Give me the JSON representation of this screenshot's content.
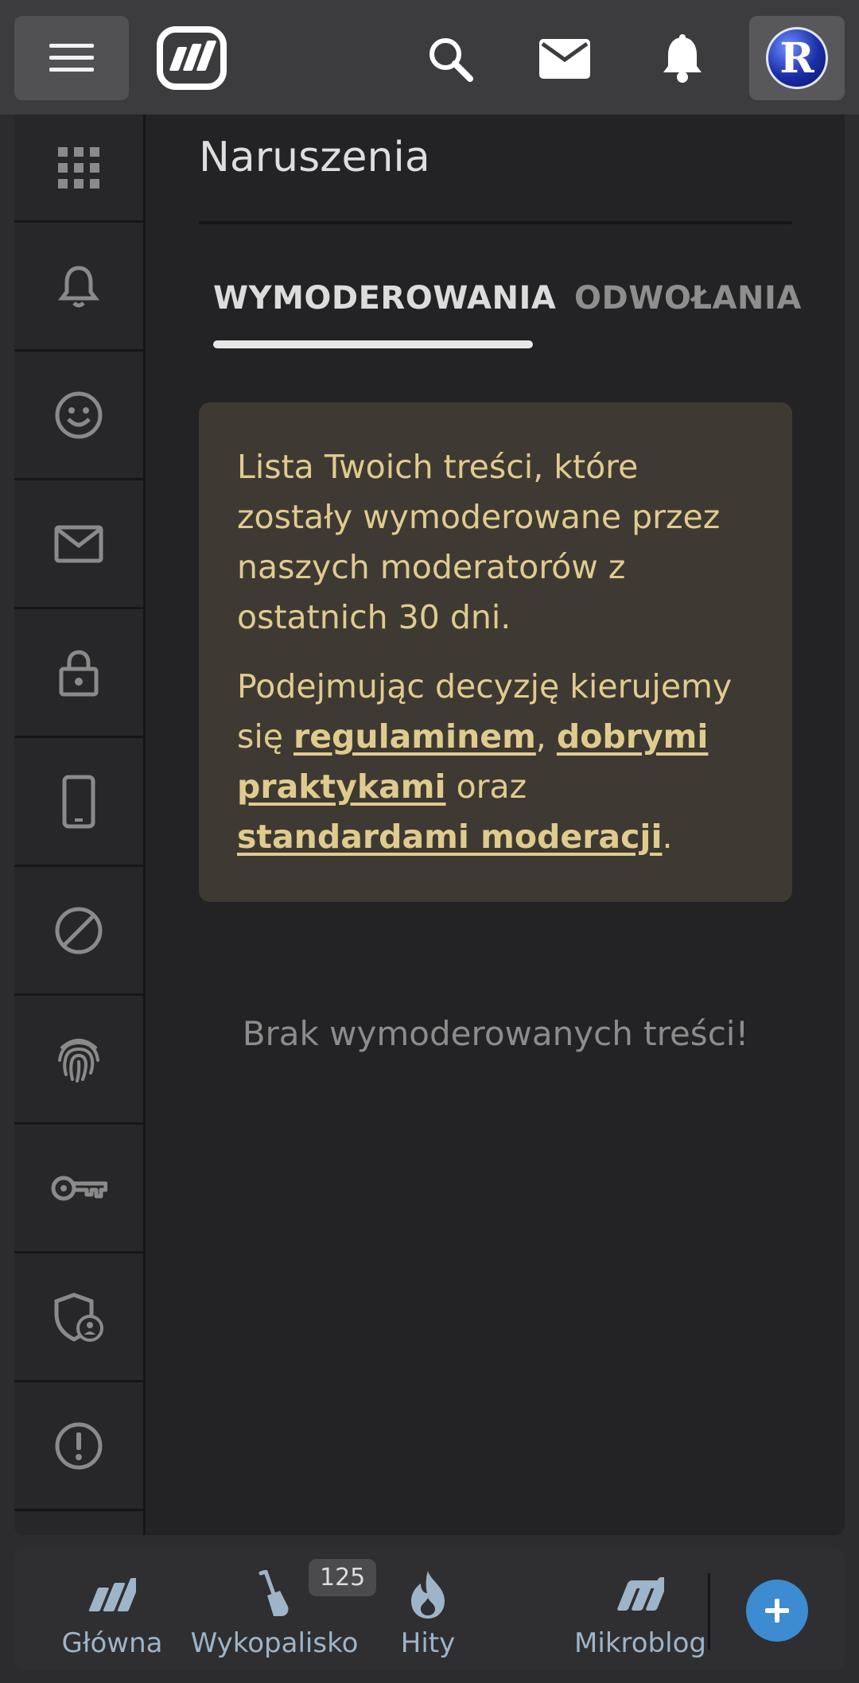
{
  "page": {
    "title": "Naruszenia"
  },
  "tabs": [
    {
      "label": "WYMODEROWANIA",
      "active": true
    },
    {
      "label": "ODWOŁANIA",
      "active": false
    }
  ],
  "notice": {
    "paragraph1": "Lista Twoich treści, które zostały wymoderowane przez naszych moderatorów z ostatnich 30 dni.",
    "p2_before": "Podejmując decyzję kierujemy się ",
    "link_regulamin": "regulaminem",
    "sep1": ", ",
    "link_praktyki": "dobrymi praktykami",
    "sep2": " oraz ",
    "link_standardy": "standardami moderacji",
    "end": "."
  },
  "empty_message": "Brak wymoderowanych treści!",
  "avatar": {
    "letter": "R"
  },
  "bottom_nav": {
    "home": "Główna",
    "wykopalisko": "Wykopalisko",
    "wykopalisko_badge": "125",
    "hits": "Hity",
    "mikroblog": "Mikroblog"
  },
  "sidebar_icons": [
    "apps-grid-icon",
    "bell-icon",
    "smiley-icon",
    "mail-icon",
    "lock-icon",
    "phone-icon",
    "block-icon",
    "fingerprint-icon",
    "key-icon",
    "shield-user-icon",
    "alert-circle-icon"
  ],
  "colors": {
    "notice_bg": "#3e3a33",
    "notice_text": "#e0cb8f",
    "fab": "#3d8bd1",
    "nav_text": "#9eb4c8"
  }
}
